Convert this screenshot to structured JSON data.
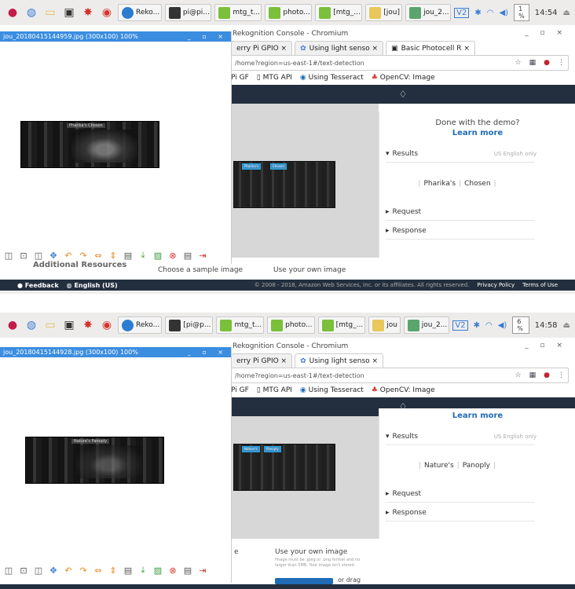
{
  "taskbar": {
    "tasks": [
      {
        "label": "Reko...",
        "color": "#2c7cd1"
      },
      {
        "label": "pi@pi...",
        "color": "#333"
      },
      {
        "label": "mtg_t...",
        "color": "#7bbf3a"
      },
      {
        "label": "photo...",
        "color": "#7bbf3a"
      },
      {
        "label": "[mtg_...",
        "color": "#7bbf3a"
      },
      {
        "label": "[jou]",
        "color": "#e8c85a"
      },
      {
        "label": "jou_2...",
        "color": "#5aa56d"
      }
    ],
    "tasks2": [
      {
        "label": "Reko...",
        "color": "#2c7cd1"
      },
      {
        "label": "[pi@p...",
        "color": "#333"
      },
      {
        "label": "mtg_t...",
        "color": "#7bbf3a"
      },
      {
        "label": "photo...",
        "color": "#7bbf3a"
      },
      {
        "label": "[mtg_...",
        "color": "#7bbf3a"
      },
      {
        "label": "jou",
        "color": "#e8c85a"
      },
      {
        "label": "jou_2...",
        "color": "#5aa56d"
      }
    ],
    "cpu1": "1 %",
    "time1": "14:54",
    "cpu2": "6 %",
    "time2": "14:58"
  },
  "browser": {
    "title": "Rekognition Console - Chromium",
    "tabs1": [
      "erry Pi GPIO ×",
      "Using light senso ×",
      "Basic Photocell R ×"
    ],
    "tabs2": [
      "erry Pi GPIO ×",
      "Using light senso ×"
    ],
    "url": "/home?region=us-east-1#/text-detection",
    "bookmarks": [
      "Pi GF",
      "MTG API",
      "Using Tesseract",
      "OpenCV: Image"
    ]
  },
  "panel": {
    "done": "Done with the demo?",
    "learn": "Learn more",
    "results": "Results",
    "lang": "US English only",
    "result1": [
      "Pharika's",
      "Chosen"
    ],
    "result2": [
      "Nature's",
      "Panoply"
    ],
    "request": "Request",
    "response": "Response"
  },
  "bottom": {
    "choose": "Choose a sample image",
    "own": "Use your own image",
    "additional": "Additional Resources",
    "own_title2": "Use your own image",
    "own_hint2": "Image must be .jpeg or .png format and no larger than 5MB. Your image isn't stored.",
    "drag2": "or drag",
    "choose_partial2": "e"
  },
  "footer": {
    "feedback": "Feedback",
    "lang": "English (US)",
    "copyright": "© 2008 - 2018, Amazon Web Services, Inc. or its affiliates. All rights reserved.",
    "privacy": "Privacy Policy",
    "terms": "Terms of Use"
  },
  "viewer": {
    "title1": "jou_20180415144959.jpg (300x100) 100%",
    "title2": "jou_20180415144928.jpg (300x100) 100%",
    "label1": "Pharika's Chosen",
    "label2": "Nature's Panoply",
    "box1": "Pharika's",
    "box1b": "Chosen",
    "box2": "Nature's",
    "box2b": "Panoply"
  }
}
